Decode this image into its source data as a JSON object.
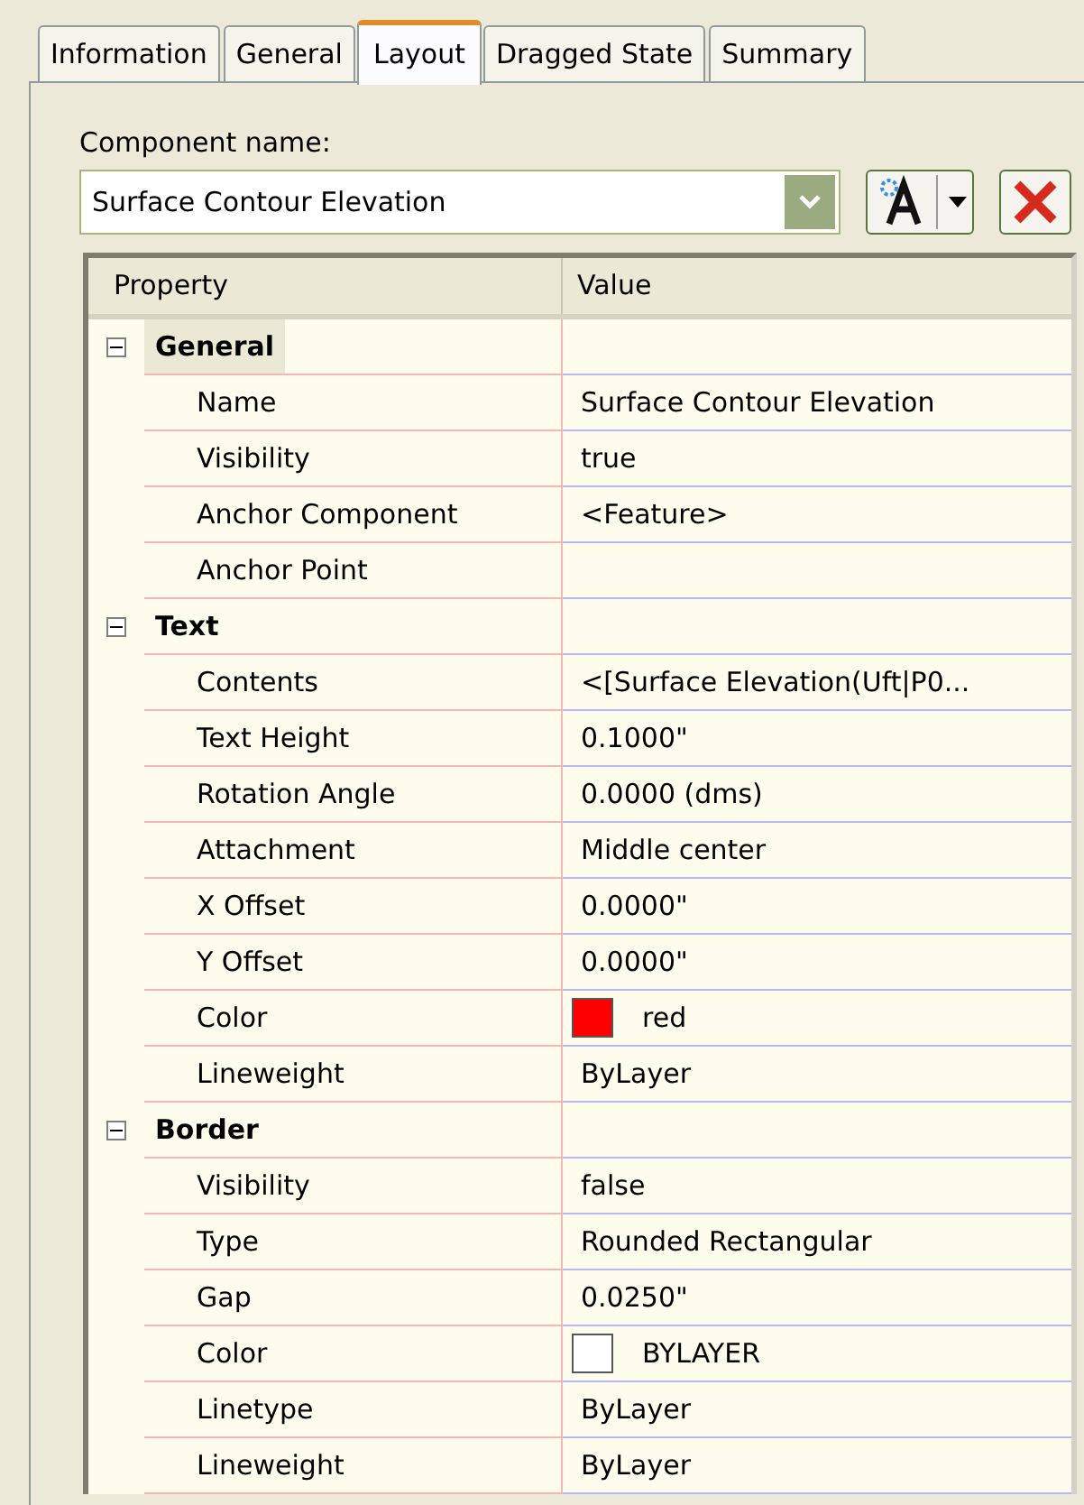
{
  "tabs": [
    {
      "label": "Information",
      "selected": false
    },
    {
      "label": "General",
      "selected": false
    },
    {
      "label": "Layout",
      "selected": true
    },
    {
      "label": "Dragged State",
      "selected": false
    },
    {
      "label": "Summary",
      "selected": false
    }
  ],
  "component_name": {
    "label": "Component name:",
    "value": "Surface Contour Elevation"
  },
  "grid": {
    "columns": [
      "Property",
      "Value"
    ],
    "groups": [
      {
        "label": "General",
        "expanded": true,
        "selected": true,
        "rows": [
          {
            "property": "Name",
            "value": "Surface Contour Elevation"
          },
          {
            "property": "Visibility",
            "value": "true"
          },
          {
            "property": "Anchor Component",
            "value": "<Feature>"
          },
          {
            "property": "Anchor Point"
          }
        ]
      },
      {
        "label": "Text",
        "expanded": true,
        "selected": false,
        "rows": [
          {
            "property": "Contents",
            "value": "<[Surface Elevation(Uft|P0..."
          },
          {
            "property": "Text Height",
            "value": "0.1000\""
          },
          {
            "property": "Rotation Angle",
            "value": "0.0000 (dms)"
          },
          {
            "property": "Attachment",
            "value": "Middle center"
          },
          {
            "property": "X Offset",
            "value": "0.0000\""
          },
          {
            "property": "Y Offset",
            "value": "0.0000\""
          },
          {
            "property": "Color",
            "value": "red",
            "kind": "color",
            "color": "#ff0000"
          },
          {
            "property": "Lineweight",
            "value": "ByLayer"
          }
        ]
      },
      {
        "label": "Border",
        "expanded": true,
        "selected": false,
        "rows": [
          {
            "property": "Visibility",
            "value": "false"
          },
          {
            "property": "Type",
            "value": "Rounded Rectangular"
          },
          {
            "property": "Gap",
            "value": "0.0250\""
          },
          {
            "property": "Color",
            "value": "BYLAYER",
            "kind": "color",
            "color": "#ffffff"
          },
          {
            "property": "Linetype",
            "value": "ByLayer"
          },
          {
            "property": "Lineweight",
            "value": "ByLayer"
          }
        ]
      }
    ]
  }
}
